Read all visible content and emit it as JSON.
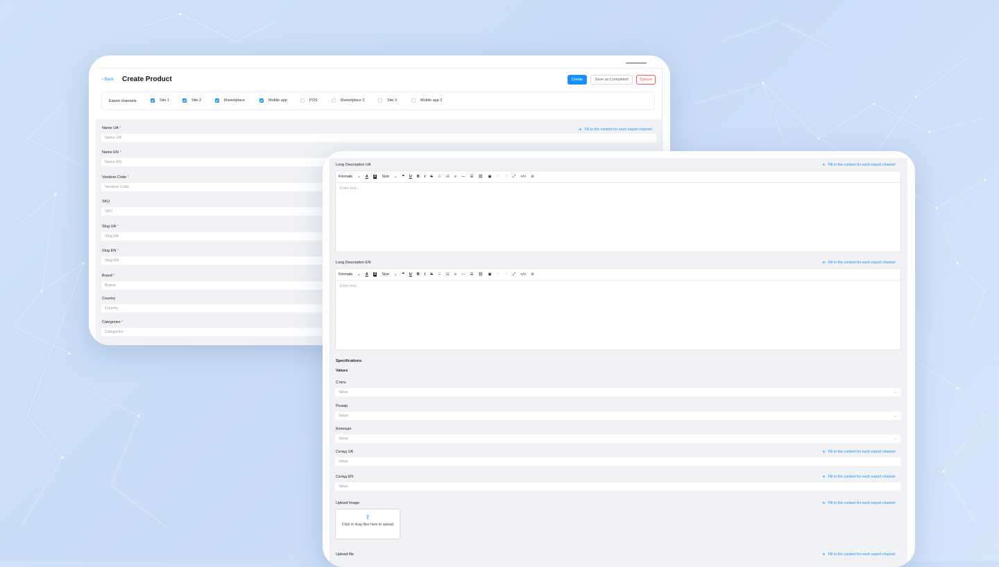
{
  "card_a": {
    "back_label": "Back",
    "title": "Create Product",
    "buttons": {
      "create": "Create",
      "save": "Save as Completed",
      "cancel": "Cancel"
    },
    "export_label": "Export channels",
    "channels": [
      {
        "label": "Site 1",
        "checked": true
      },
      {
        "label": "Site 2",
        "checked": true
      },
      {
        "label": "Marketplace",
        "checked": true
      },
      {
        "label": "Mobile app",
        "checked": true
      },
      {
        "label": "POS",
        "checked": false
      },
      {
        "label": "Marketplace 2",
        "checked": false
      },
      {
        "label": "Site 3",
        "checked": false
      },
      {
        "label": "Mobile app 2",
        "checked": false
      }
    ],
    "fields": [
      {
        "label": "Name UA",
        "required": "*",
        "placeholder": "Name UA"
      },
      {
        "label": "Name EN",
        "required": "*",
        "placeholder": "Name EN"
      },
      {
        "label": "Vendore Code",
        "required": "*",
        "placeholder": "Vendore Code"
      },
      {
        "label": "SKU",
        "required": "",
        "placeholder": "SKU"
      },
      {
        "label": "Slug UA",
        "required": "*",
        "placeholder": "Slug UA"
      },
      {
        "label": "Slug EN",
        "required": "*",
        "placeholder": "Slug EN"
      },
      {
        "label": "Brand",
        "required": "*",
        "placeholder": "Brand"
      },
      {
        "label": "Country",
        "required": "",
        "placeholder": "Country"
      },
      {
        "label": "Categories",
        "required": "*",
        "placeholder": "Categories"
      }
    ],
    "fill_link": "Fill in the content for each export channel"
  },
  "card_b": {
    "fill_link": "Fill in the content for each export channel",
    "long_desc_ua": "Long Description UA",
    "long_desc_en": "Long Description EN",
    "toolbar": {
      "formats": "Formats",
      "size": "Size"
    },
    "editor_placeholder": "Enter text...",
    "specifications": "Specifications",
    "values": "Values",
    "spec_fields": [
      {
        "label": "Стать",
        "placeholder": "Value"
      },
      {
        "label": "Розмір",
        "placeholder": "Value"
      },
      {
        "label": "Колекція",
        "placeholder": "Value"
      }
    ],
    "sklad_ua": {
      "label": "Склад UA",
      "placeholder": "Value"
    },
    "sklad_en": {
      "label": "Склад EN",
      "placeholder": "Value"
    },
    "upload_image": "Upload Image",
    "upload_text": "Click or drag files here to upload",
    "upload_file": "Upload file"
  },
  "colors": {
    "accent": "#1890ff",
    "danger": "#ff4d4f",
    "panel": "#f0f2f5",
    "background": "#cfe2f7"
  },
  "icons": [
    "chevron-left-icon",
    "plus-icon",
    "check-icon",
    "chevron-down-icon",
    "upload-icon",
    "bold-icon",
    "italic-icon",
    "underline-icon",
    "strikethrough-icon",
    "link-icon",
    "image-icon",
    "code-icon",
    "fullscreen-icon",
    "quote-icon",
    "list-icon",
    "align-left-icon"
  ]
}
